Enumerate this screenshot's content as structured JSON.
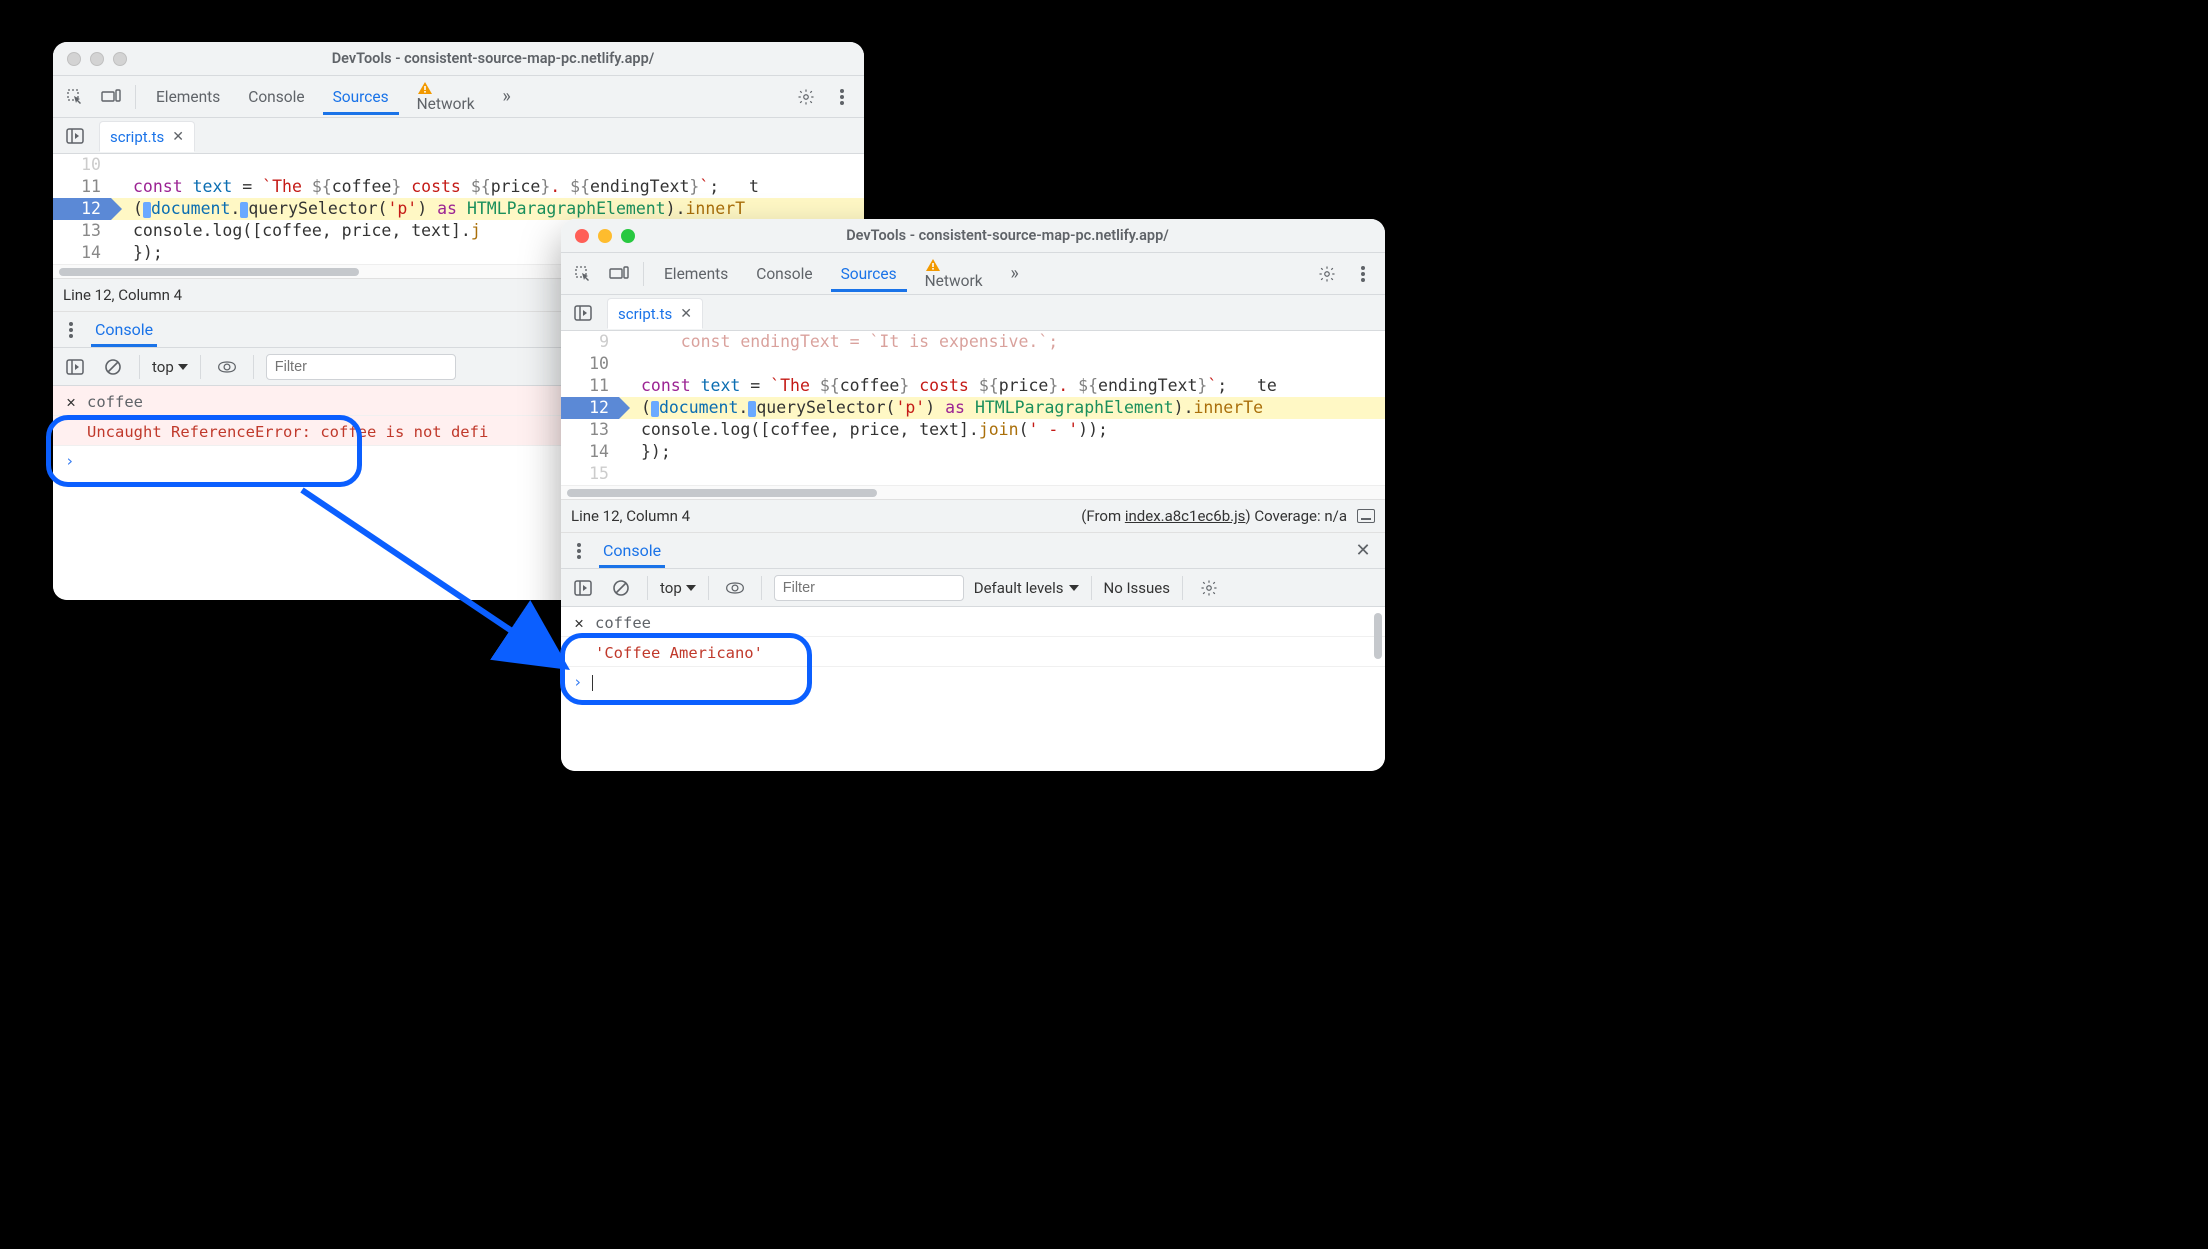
{
  "title": "DevTools - consistent-source-map-pc.netlify.app/",
  "tabs": {
    "elements": "Elements",
    "console": "Console",
    "sources": "Sources",
    "network": "Network"
  },
  "file": {
    "name": "script.ts"
  },
  "code": {
    "l9": "    const endingText = `It is expensive.`;",
    "l11_a": "const",
    "l11_b": "text",
    "l11_c": " = ",
    "l11_s1": "`The ",
    "l11_t1o": "${",
    "l11_t1": "coffee",
    "l11_t1c": "}",
    "l11_s2": " costs ",
    "l11_t2o": "${",
    "l11_t2": "price",
    "l11_t2c": "}",
    "l11_s3": ". ",
    "l11_t3o": "${",
    "l11_t3": "endingText",
    "l11_t3c": "}",
    "l11_s4": "`",
    "l11_end": ";   t",
    "l11_end2": ";   te",
    "l12_a": "(",
    "l12_b": "document",
    "l12_dot": ".",
    "l12_q": "querySelector",
    "l12_c": "(",
    "l12_d": "'p'",
    "l12_e": ")",
    "l12_as": " as ",
    "l12_t": "HTMLParagraphElement",
    "l12_f": ")",
    "l12_g": ".",
    "l12_h": "innerT",
    "l12_h2": "innerTe",
    "l13_a": "console",
    "l13_b": ".log(",
    "l13_c": "[",
    "l13_d": "coffee",
    "l13_e": ", ",
    "l13_f": "price",
    "l13_g": ", ",
    "l13_h": "text",
    "l13_i": "].",
    "l13_j1": "j",
    "l13_j2": "join",
    "l13_k": "(",
    "l13_l": "' - '",
    "l13_m": "));",
    "l14": "});"
  },
  "status": {
    "pos": "Line 12, Column 4",
    "from": "(From ",
    "file_a": "index.",
    "file_b": "index.a8c1ec6b.js",
    "coverage": ") Coverage: n/a"
  },
  "drawer": {
    "console": "Console"
  },
  "console_tb": {
    "scope": "top",
    "filter_ph": "Filter",
    "levels": "Default levels",
    "levels_short": "Def",
    "issues": "No Issues"
  },
  "winA": {
    "input": "coffee",
    "err1": "Uncaught ReferenceError:",
    "err2": "coffee is not defi"
  },
  "winB": {
    "input": "coffee",
    "out": "'Coffee Americano'"
  }
}
